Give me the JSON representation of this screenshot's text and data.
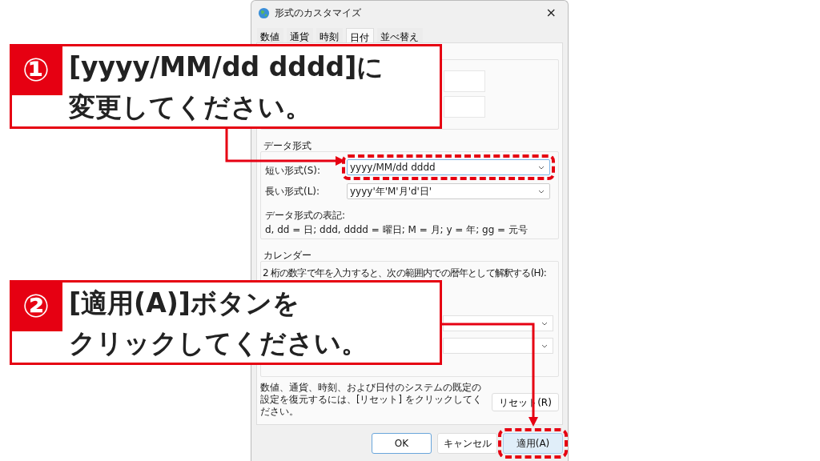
{
  "window": {
    "title": "形式のカスタマイズ",
    "close": "×"
  },
  "tabs": [
    {
      "label": "数値",
      "selected": false
    },
    {
      "label": "通貨",
      "selected": false
    },
    {
      "label": "時刻",
      "selected": false
    },
    {
      "label": "日付",
      "selected": true
    },
    {
      "label": "並べ替え",
      "selected": false
    }
  ],
  "data_format": {
    "legend": "データ形式",
    "fields": [
      {
        "label": "短い形式(S):",
        "value": "yyyy/MM/dd dddd",
        "focused": true
      },
      {
        "label": "長い形式(L):",
        "value": "yyyy'年'M'月'd'日'",
        "focused": false
      }
    ],
    "notation_title": "データ形式の表記:",
    "notation": "d, dd = 日;  ddd, dddd = 曜日; M = 月; y = 年; gg = 元号"
  },
  "calendar": {
    "legend": "カレンダー",
    "two_digit_year": "2 桁の数字で年を入力すると、次の範囲内での暦年として解釈する(H):"
  },
  "reset_note": "数値、通貨、時刻、および日付のシステムの既定の設定を復元するには、[リセット] をクリックしてください。",
  "reset_button": "リセット(R)",
  "buttons": [
    {
      "label": "OK",
      "kind": "default",
      "highlighted": false
    },
    {
      "label": "キャンセル",
      "kind": "normal",
      "highlighted": false
    },
    {
      "label": "適用(A)",
      "kind": "hover",
      "highlighted": true
    }
  ],
  "callouts": [
    {
      "number": "①",
      "lines": [
        "[yyyy/MM/dd dddd]に",
        "変更してください。"
      ]
    },
    {
      "number": "②",
      "lines": [
        "[適用(A)]ボタンを",
        "クリックしてください。"
      ]
    }
  ]
}
